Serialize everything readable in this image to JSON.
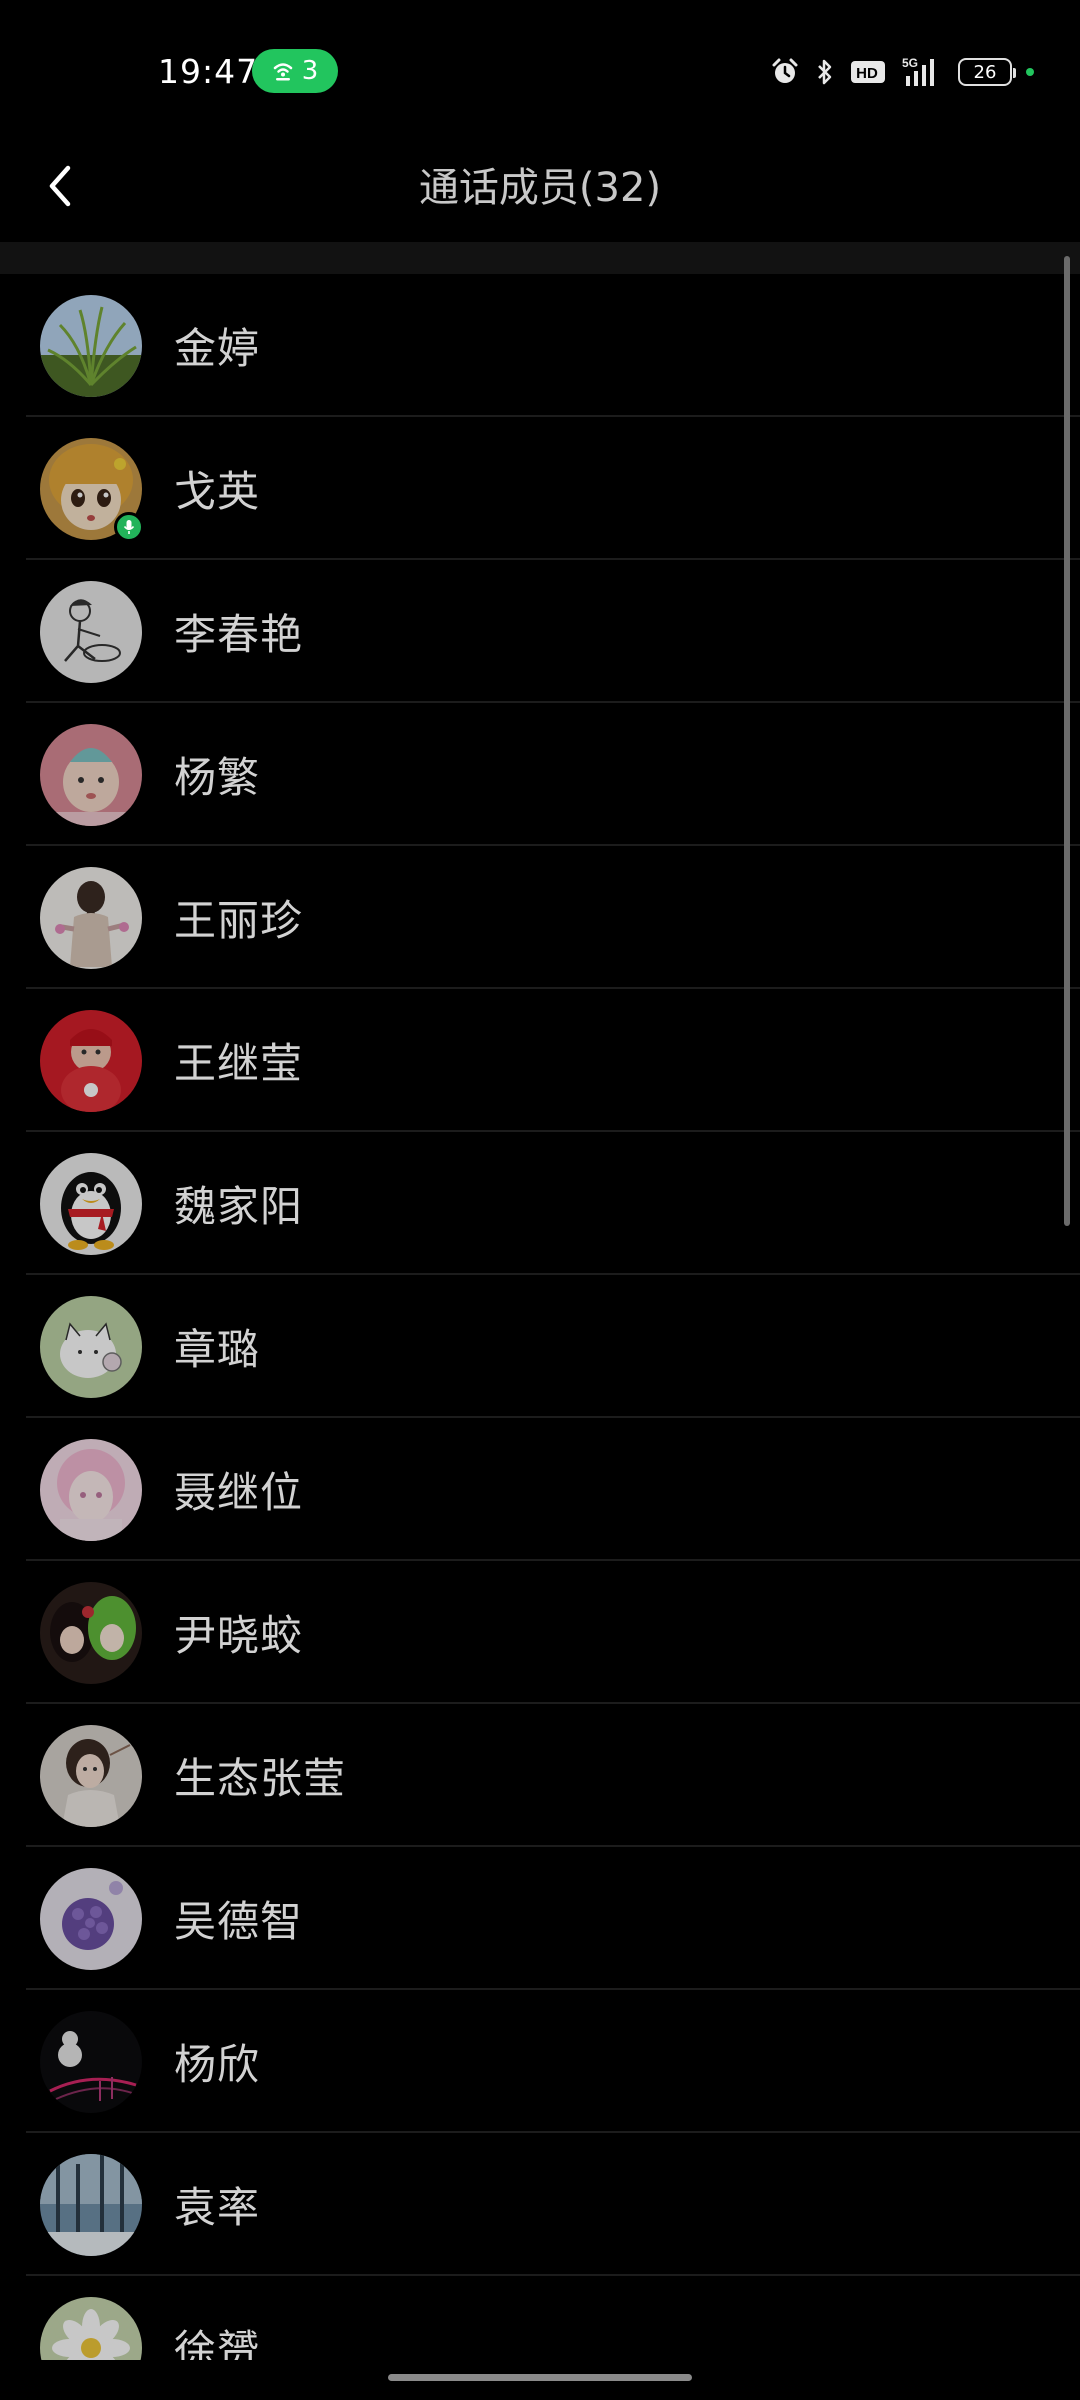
{
  "status_bar": {
    "time": "19:47",
    "hotspot_count": "3",
    "network": "5G",
    "hd_label": "HD",
    "battery": "26",
    "icons": [
      "alarm-icon",
      "bluetooth-icon",
      "hd-icon",
      "signal-icon",
      "battery-icon"
    ]
  },
  "header": {
    "title": "通话成员(32)",
    "back_icon": "chevron-left-icon"
  },
  "members": [
    {
      "name": "金婷",
      "speaking": false,
      "avatar": "grass"
    },
    {
      "name": "戈英",
      "speaking": true,
      "avatar": "cartoon-girl"
    },
    {
      "name": "李春艳",
      "speaking": false,
      "avatar": "sketch"
    },
    {
      "name": "杨繁",
      "speaking": false,
      "avatar": "baby-pink"
    },
    {
      "name": "王丽珍",
      "speaking": false,
      "avatar": "girl-braid"
    },
    {
      "name": "王继莹",
      "speaking": false,
      "avatar": "baby-red"
    },
    {
      "name": "魏家阳",
      "speaking": false,
      "avatar": "penguin"
    },
    {
      "name": "章璐",
      "speaking": false,
      "avatar": "cat-cartoon"
    },
    {
      "name": "聂继位",
      "speaking": false,
      "avatar": "anime-pink"
    },
    {
      "name": "尹晓蛟",
      "speaking": false,
      "avatar": "anime-duo"
    },
    {
      "name": "生态张莹",
      "speaking": false,
      "avatar": "portrait-woman"
    },
    {
      "name": "吴德智",
      "speaking": false,
      "avatar": "purple-flower"
    },
    {
      "name": "杨欣",
      "speaking": false,
      "avatar": "dark-gourd"
    },
    {
      "name": "袁率",
      "speaking": false,
      "avatar": "snow-forest"
    },
    {
      "name": "徐赟",
      "speaking": false,
      "avatar": "white-flower"
    }
  ],
  "colors": {
    "background": "#000000",
    "accent_green": "#22c55e",
    "text": "#d2d2d2"
  }
}
